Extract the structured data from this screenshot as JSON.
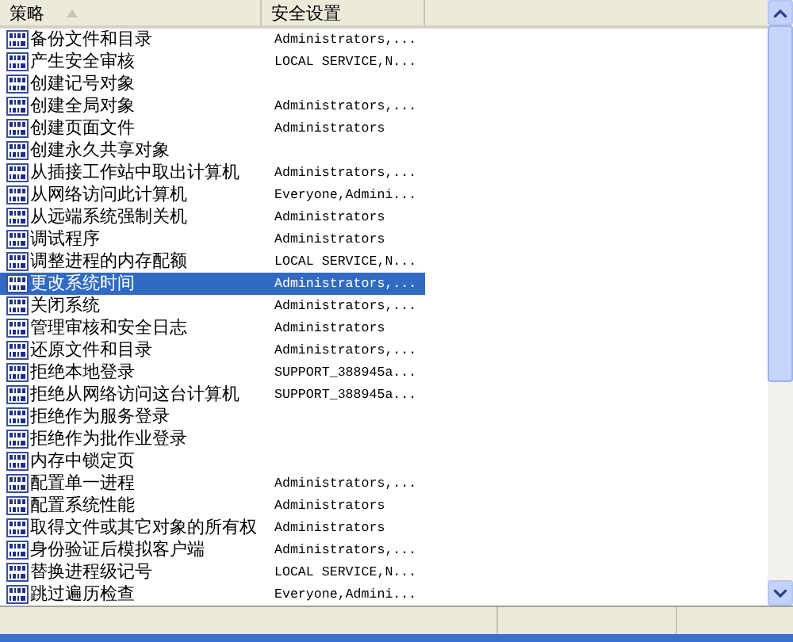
{
  "table": {
    "columns": [
      {
        "label": "策略",
        "sorted": true
      },
      {
        "label": "安全设置",
        "sorted": false
      }
    ],
    "rows": [
      {
        "policy": "备份文件和目录",
        "setting": "Administrators,...",
        "selected": false
      },
      {
        "policy": "产生安全审核",
        "setting": "LOCAL SERVICE,N...",
        "selected": false
      },
      {
        "policy": "创建记号对象",
        "selected": false
      },
      {
        "policy": "创建全局对象",
        "setting": "Administrators,...",
        "selected": false
      },
      {
        "policy": "创建页面文件",
        "setting": "Administrators",
        "selected": false
      },
      {
        "policy": "创建永久共享对象",
        "selected": false
      },
      {
        "policy": "从插接工作站中取出计算机",
        "setting": "Administrators,...",
        "selected": false
      },
      {
        "policy": "从网络访问此计算机",
        "setting": "Everyone,Admini...",
        "selected": false
      },
      {
        "policy": "从远端系统强制关机",
        "setting": "Administrators",
        "selected": false
      },
      {
        "policy": "调试程序",
        "setting": "Administrators",
        "selected": false
      },
      {
        "policy": "调整进程的内存配额",
        "setting": "LOCAL SERVICE,N...",
        "selected": false
      },
      {
        "policy": "更改系统时间",
        "setting": "Administrators,...",
        "selected": true
      },
      {
        "policy": "关闭系统",
        "setting": "Administrators,...",
        "selected": false
      },
      {
        "policy": "管理审核和安全日志",
        "setting": "Administrators",
        "selected": false
      },
      {
        "policy": "还原文件和目录",
        "setting": "Administrators,...",
        "selected": false
      },
      {
        "policy": "拒绝本地登录",
        "setting": "SUPPORT_388945a...",
        "selected": false
      },
      {
        "policy": "拒绝从网络访问这台计算机",
        "setting": "SUPPORT_388945a...",
        "selected": false
      },
      {
        "policy": "拒绝作为服务登录",
        "selected": false
      },
      {
        "policy": "拒绝作为批作业登录",
        "selected": false
      },
      {
        "policy": "内存中锁定页",
        "selected": false
      },
      {
        "policy": "配置单一进程",
        "setting": "Administrators,...",
        "selected": false
      },
      {
        "policy": "配置系统性能",
        "setting": "Administrators",
        "selected": false
      },
      {
        "policy": "取得文件或其它对象的所有权",
        "setting": "Administrators",
        "selected": false
      },
      {
        "policy": "身份验证后模拟客户端",
        "setting": "Administrators,...",
        "selected": false
      },
      {
        "policy": "替换进程级记号",
        "setting": "LOCAL SERVICE,N...",
        "selected": false
      },
      {
        "policy": "跳过遍历检查",
        "setting": "Everyone,Admini...",
        "selected": false
      }
    ]
  }
}
